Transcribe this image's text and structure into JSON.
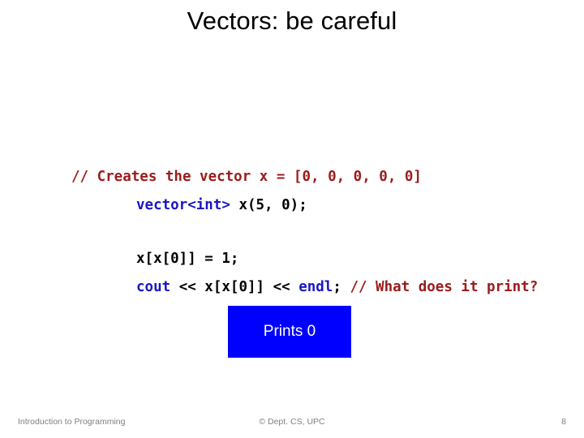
{
  "slide": {
    "title": "Vectors: be careful",
    "page_number": "8"
  },
  "code_block_1": {
    "line_1_comment": "// Creates the vector x = [0, 0, 0, 0, 0]",
    "line_2_keyword": "vector<int>",
    "line_2_plain": " x(5, 0);"
  },
  "code_block_2": {
    "line_1_plain": "x[x[0]] = 1;",
    "line_2_keyword_cout": "cout",
    "line_2_plain_mid": " << x[x[0]] << ",
    "line_2_keyword_endl": "endl",
    "line_2_plain_semi": "; ",
    "line_2_comment": "// What does it print?"
  },
  "callout": {
    "text": "Prints 0"
  },
  "footer": {
    "left": "Introduction to Programming",
    "center": "© Dept. CS, UPC",
    "right": "8"
  },
  "colors": {
    "comment": "#9B1C1C",
    "keyword": "#1A17C4",
    "plain": "#000000",
    "callout_bg": "#0000FF",
    "callout_fg": "#FFFFFF",
    "footer_fg": "#808080",
    "title_fg": "#000000"
  }
}
